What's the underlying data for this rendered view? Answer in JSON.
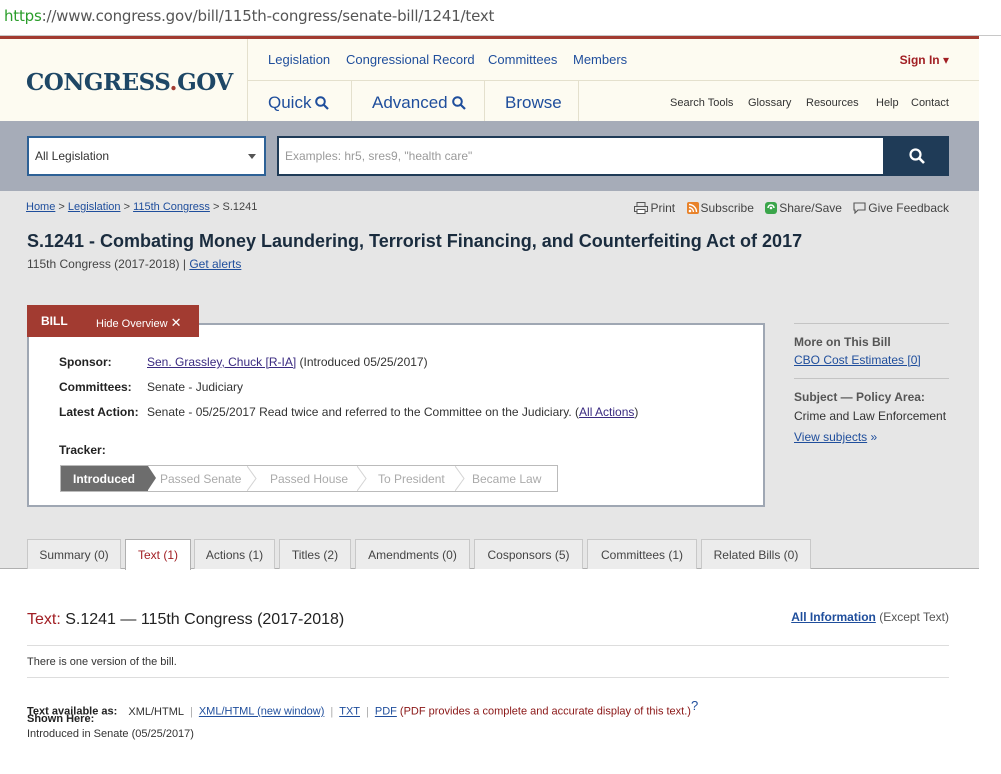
{
  "browser": {
    "url_scheme": "https",
    "url_rest": "://www.congress.gov/bill/115th-congress/senate-bill/1241/text"
  },
  "header": {
    "logo_main": "CONGRESS",
    "logo_dot": ".",
    "logo_gov": "GOV",
    "nav": [
      "Legislation",
      "Congressional Record",
      "Committees",
      "Members"
    ],
    "sign_in": "Sign In",
    "search_tabs": [
      "Quick",
      "Advanced",
      "Browse"
    ],
    "links": [
      "Search Tools",
      "Glossary",
      "Resources",
      "Help",
      "Contact"
    ]
  },
  "search": {
    "scope": "All Legislation",
    "placeholder": "Examples: hr5, sres9, \"health care\""
  },
  "breadcrumb": {
    "home": "Home",
    "legislation": "Legislation",
    "congress": "115th Congress",
    "sep": ">",
    "current": "S.1241"
  },
  "tools": {
    "print": "Print",
    "subscribe": "Subscribe",
    "share": "Share/Save",
    "feedback": "Give Feedback"
  },
  "bill": {
    "title": "S.1241 - Combating Money Laundering, Terrorist Financing, and Counterfeiting Act of 2017",
    "subtitle": "115th Congress (2017-2018) | ",
    "get_alerts": "Get alerts",
    "tab_label": "BILL",
    "hide_overview": "Hide Overview",
    "sponsor_label": "Sponsor:",
    "sponsor_name": "Sen. Grassley, Chuck [R-IA]",
    "sponsor_intro": " (Introduced 05/25/2017)",
    "committees_label": "Committees:",
    "committees_value": "Senate - Judiciary",
    "latest_label": "Latest Action:",
    "latest_value": "Senate - 05/25/2017 Read twice and referred to the Committee on the Judiciary.  (",
    "all_actions": "All Actions",
    "latest_close": ")",
    "tracker_label": "Tracker:",
    "tracker_steps": [
      "Introduced",
      "Passed Senate",
      "Passed House",
      "To President",
      "Became Law"
    ]
  },
  "side": {
    "more_title": "More on This Bill",
    "cbo": "CBO Cost Estimates [0]",
    "subject_title": "Subject — Policy Area:",
    "subject_value": "Crime and Law Enforcement",
    "view_subjects": "View subjects",
    "view_subjects_arrow": " »"
  },
  "tabs": [
    "Summary (0)",
    "Text (1)",
    "Actions (1)",
    "Titles (2)",
    "Amendments (0)",
    "Cosponsors (5)",
    "Committees (1)",
    "Related Bills (0)"
  ],
  "text_section": {
    "heading_label": "Text:",
    "heading": " S.1241 — 115th Congress (2017-2018)",
    "all_info": "All Information",
    "except_text": " (Except Text)",
    "one_version": "There is one version of the bill.",
    "available_label": "Text available as:",
    "formats": [
      "XML/HTML",
      "XML/HTML (new window)",
      "TXT",
      "PDF"
    ],
    "pdf_note": "(PDF provides a complete and accurate display of this text.)",
    "help_mark": "?",
    "shown_here": "Shown Here:",
    "version": "Introduced in Senate (05/25/2017)"
  }
}
